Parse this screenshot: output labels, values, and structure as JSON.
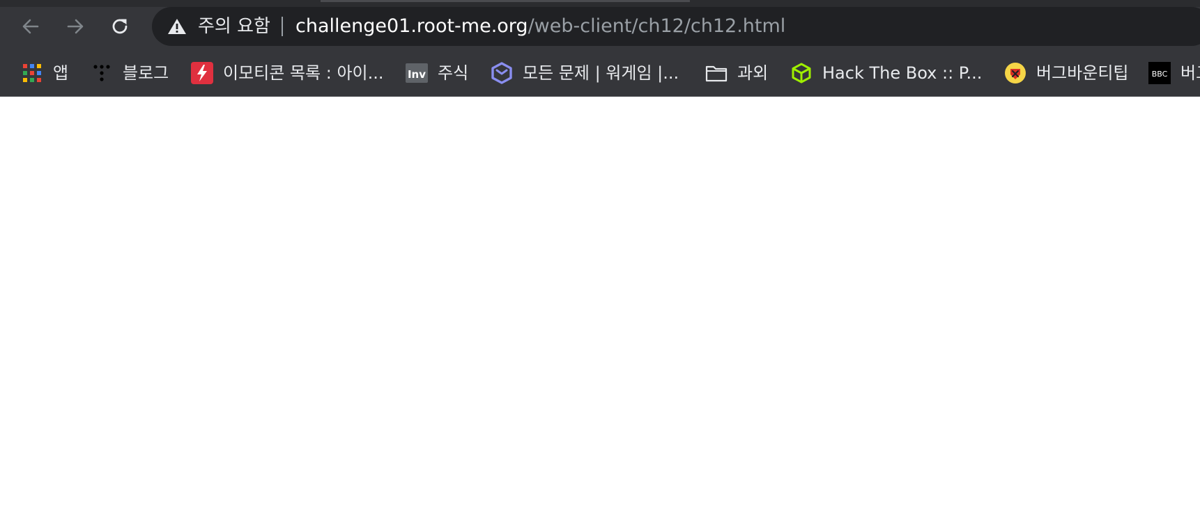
{
  "colors": {
    "chrome_bg": "#35363a",
    "omnibox_bg": "#202124",
    "text_primary": "#e8eaed",
    "url_path": "#9aa0a6",
    "page_bg": "#ffffff"
  },
  "toolbar": {
    "back_icon": "arrow-left-icon",
    "forward_icon": "arrow-right-icon",
    "reload_icon": "reload-icon"
  },
  "omnibox": {
    "security_icon": "warning-triangle-icon",
    "security_label": "주의 요함",
    "url_host": "challenge01.root-me.org",
    "url_path": "/web-client/ch12/ch12.html"
  },
  "bookmarks": [
    {
      "label": "앱",
      "icon": "apps-grid-icon"
    },
    {
      "label": "블로그",
      "icon": "dots-logo-icon"
    },
    {
      "label": "이모티콘 목록 : 아이...",
      "icon": "lightning-icon"
    },
    {
      "label": "주식",
      "icon": "inv-logo-icon",
      "icon_text": "Inv"
    },
    {
      "label": "모든 문제 | 워게임 |...",
      "icon": "wargame-logo-icon"
    },
    {
      "label": "과외",
      "icon": "folder-icon"
    },
    {
      "label": "Hack The Box :: P...",
      "icon": "cube-icon"
    },
    {
      "label": "버그바운티팁",
      "icon": "bug-badge-icon"
    },
    {
      "label": "버그",
      "icon": "bbc-logo-icon",
      "icon_text": "BBC"
    }
  ]
}
